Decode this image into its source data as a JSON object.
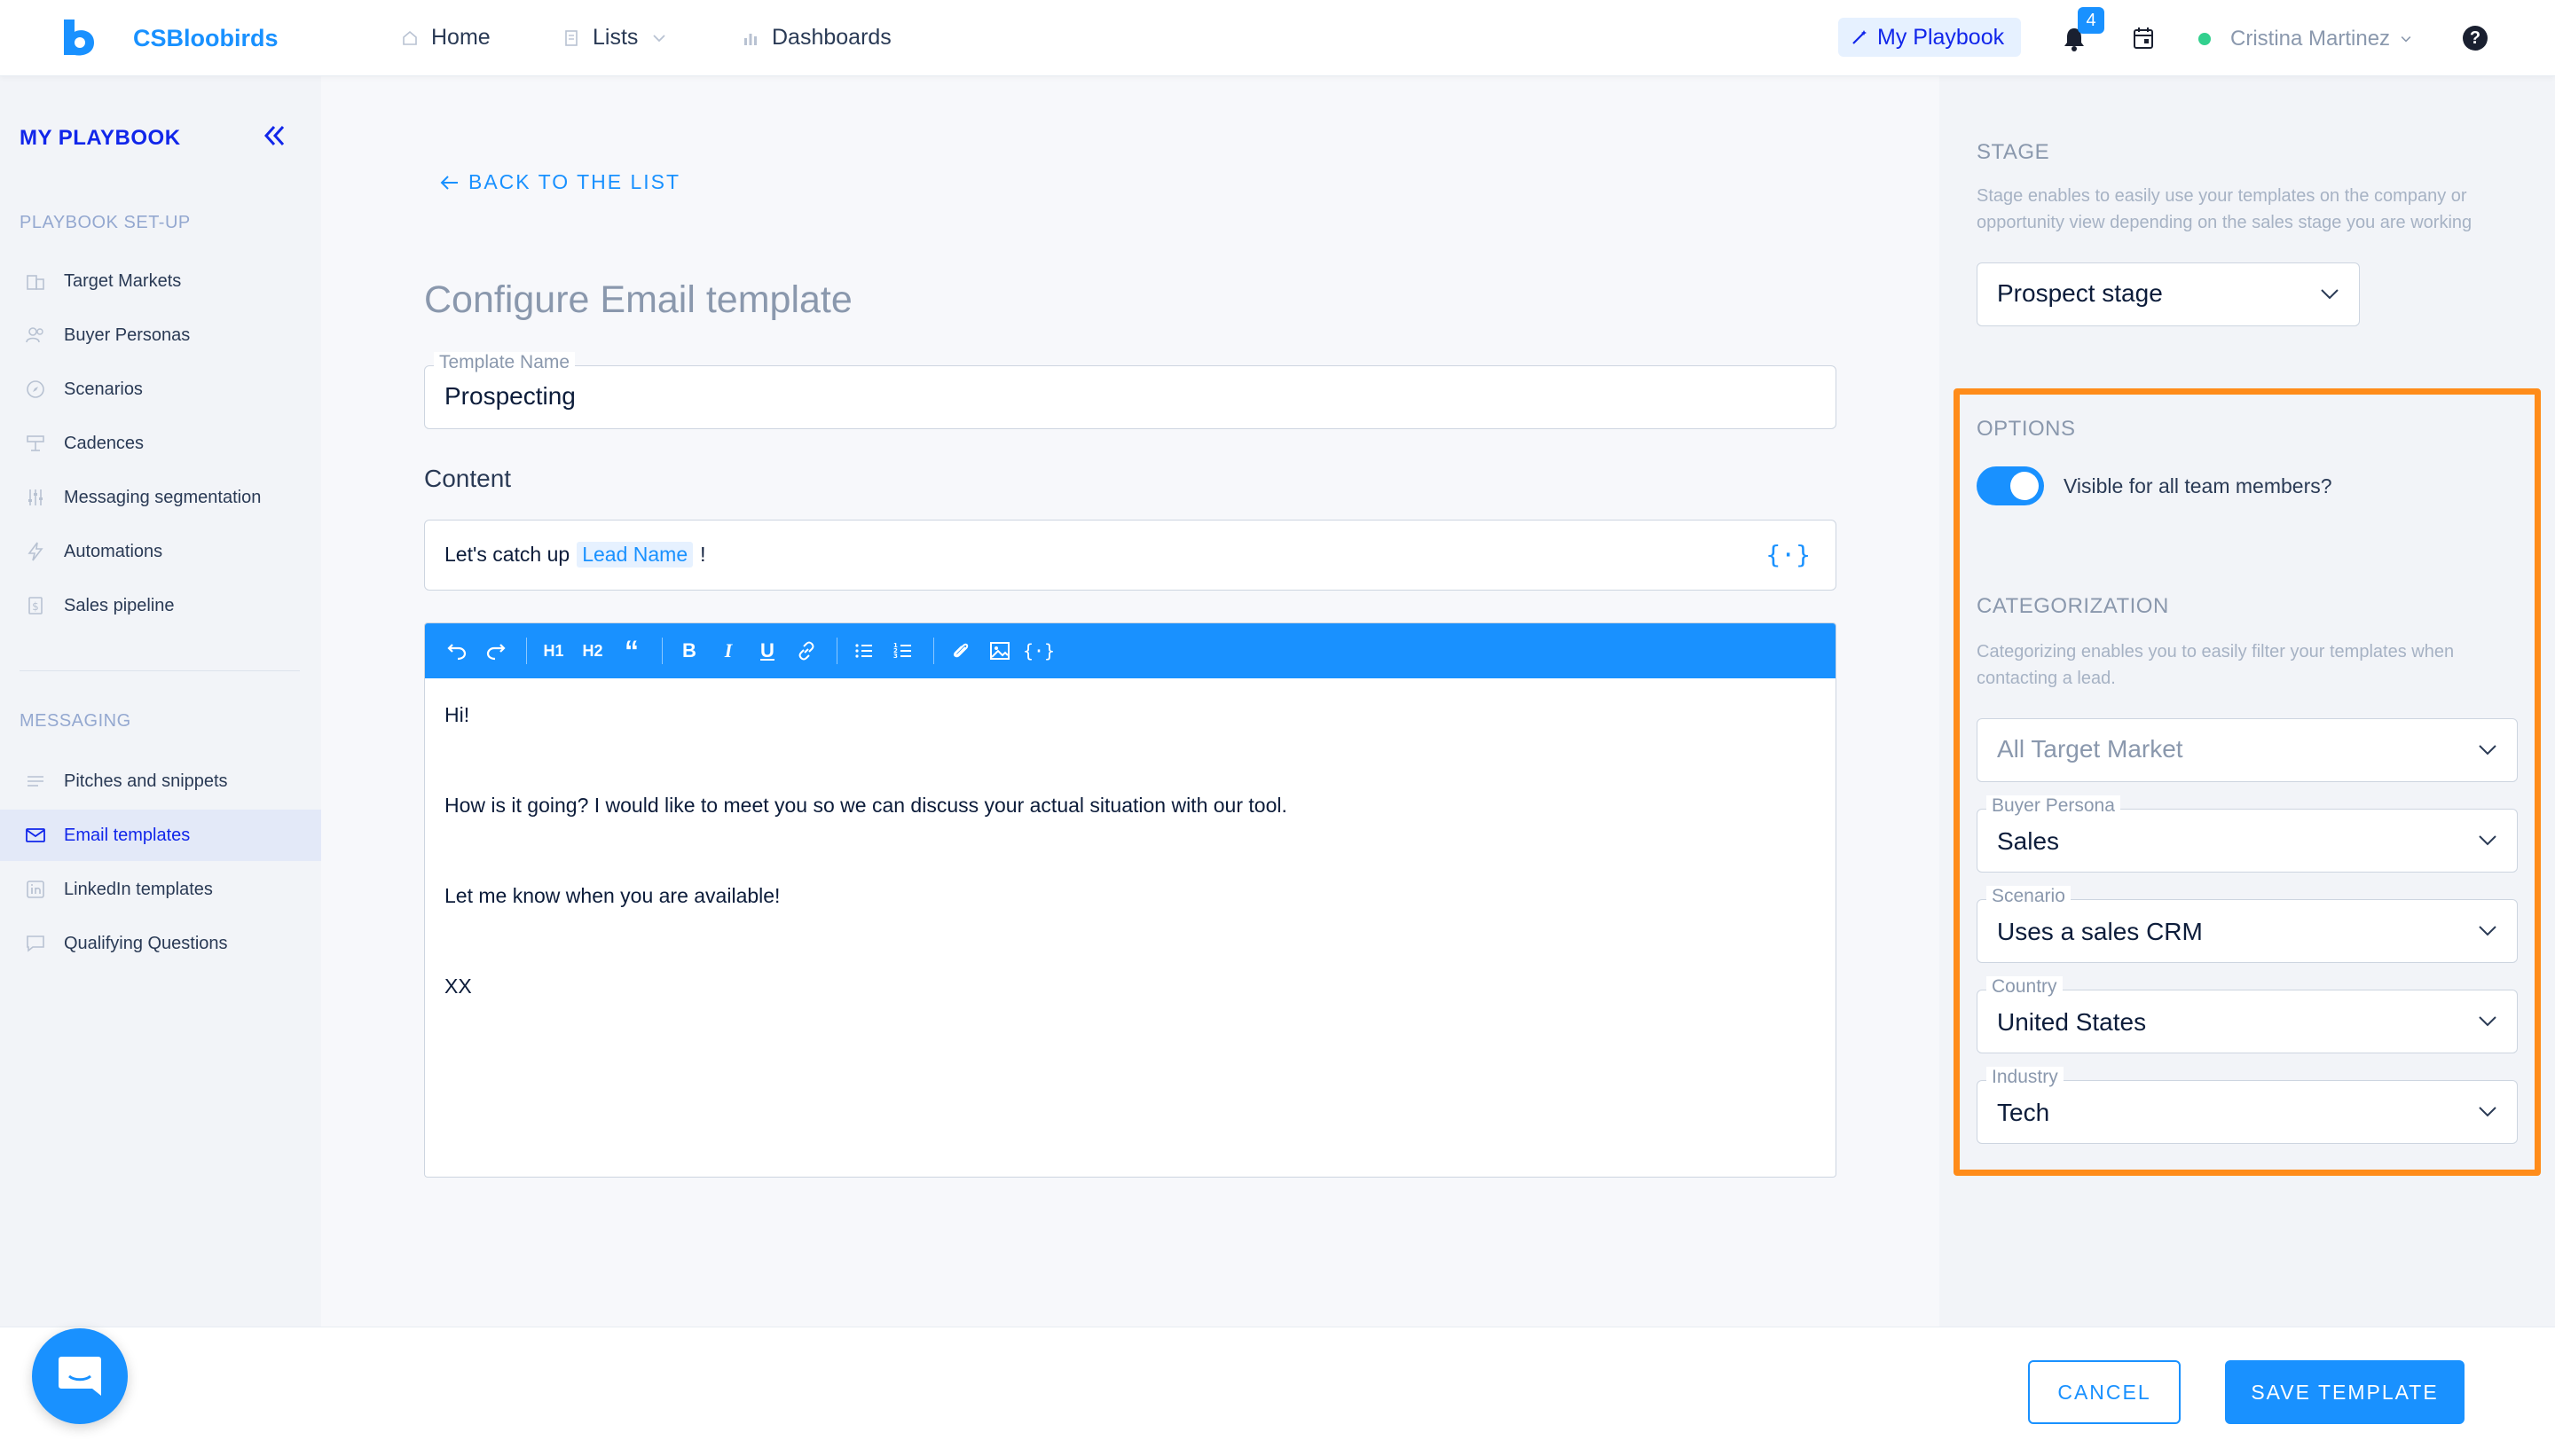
{
  "brand": {
    "name": "CSBloobirds"
  },
  "nav": {
    "home": "Home",
    "lists": "Lists",
    "dashboards": "Dashboards",
    "my_playbook": "My Playbook",
    "notifications_count": "4",
    "user_name": "Cristina Martinez",
    "help": "?"
  },
  "sidebar": {
    "title": "MY PLAYBOOK",
    "setup_section": "PLAYBOOK SET-UP",
    "setup_items": [
      {
        "label": "Target Markets",
        "icon": "building-icon"
      },
      {
        "label": "Buyer Personas",
        "icon": "users-icon"
      },
      {
        "label": "Scenarios",
        "icon": "compass-icon"
      },
      {
        "label": "Cadences",
        "icon": "cadence-icon"
      },
      {
        "label": "Messaging segmentation",
        "icon": "sliders-icon"
      },
      {
        "label": "Automations",
        "icon": "lightning-icon"
      },
      {
        "label": "Sales pipeline",
        "icon": "pipeline-icon"
      }
    ],
    "messaging_section": "MESSAGING",
    "messaging_items": [
      {
        "label": "Pitches and snippets",
        "icon": "lines-icon"
      },
      {
        "label": "Email templates",
        "icon": "mail-icon",
        "active": true
      },
      {
        "label": "LinkedIn templates",
        "icon": "linkedin-icon"
      },
      {
        "label": "Qualifying Questions",
        "icon": "chat-icon"
      }
    ]
  },
  "main": {
    "back_label": "BACK TO THE LIST",
    "title": "Configure Email template",
    "template_name_label": "Template Name",
    "template_name_value": "Prospecting",
    "content_label": "Content",
    "subject_prefix": "Let's catch up",
    "subject_variable": "Lead Name",
    "subject_suffix": "!",
    "variable_icon": "{·}",
    "toolbar": {
      "h1": "H1",
      "h2": "H2",
      "quote": "“",
      "bold": "B",
      "italic": "I",
      "underline": "U",
      "variable": "{·}"
    },
    "body_lines": [
      "Hi!",
      "How is it going? I would like to meet you so we can discuss your actual situation with our tool.",
      "Let me know when you are available!",
      "XX"
    ]
  },
  "right_panel": {
    "stage_title": "STAGE",
    "stage_desc": "Stage enables to easily use your templates on the company or opportunity view depending on the sales stage you are working",
    "stage_value": "Prospect stage",
    "options_title": "OPTIONS",
    "visible_toggle_label": "Visible for all team members?",
    "visible_toggle_on": true,
    "categorization_title": "CATEGORIZATION",
    "categorization_desc": "Categorizing enables you to easily filter your templates when contacting a lead.",
    "target_market_placeholder": "All Target Market",
    "buyer_persona_label": "Buyer Persona",
    "buyer_persona_value": "Sales",
    "scenario_label": "Scenario",
    "scenario_value": "Uses a sales CRM",
    "country_label": "Country",
    "country_value": "United States",
    "industry_label": "Industry",
    "industry_value": "Tech"
  },
  "footer": {
    "cancel": "CANCEL",
    "save": "SAVE TEMPLATE"
  },
  "colors": {
    "accent": "#1991ff",
    "brand_dark": "#1126ea",
    "highlight": "#ff8c1a",
    "online": "#32d08e"
  }
}
